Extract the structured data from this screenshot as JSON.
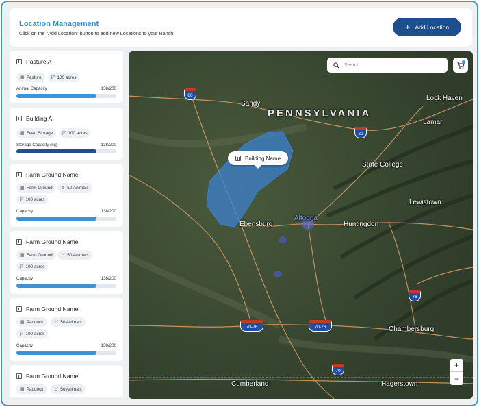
{
  "header": {
    "title": "Location Management",
    "subtitle": "Click on the \"Add Location\" button to add new Locations to your Ranch.",
    "add_button_label": "Add Location"
  },
  "colors": {
    "accent": "#3d93d6",
    "primary_button": "#1e4f8c",
    "polygon": "#3b82d6"
  },
  "locations": [
    {
      "name": "Pasture A",
      "tags": [
        {
          "icon": "grid-icon",
          "text": "Pasture"
        },
        {
          "icon": "area-icon",
          "text": "100 acres"
        }
      ],
      "bar_label": "Animal Capacity",
      "bar_value": "138/200",
      "fill_fraction": 0.8
    },
    {
      "name": "Building A",
      "tags": [
        {
          "icon": "building-icon",
          "text": "Feed Storage"
        },
        {
          "icon": "area-icon",
          "text": "100 acres"
        }
      ],
      "bar_label": "Storage Capacity (kg)",
      "bar_value": "138/200",
      "fill_fraction": 0.8
    },
    {
      "name": "Farm Ground Name",
      "tags": [
        {
          "icon": "grid-icon",
          "text": "Farm Ground"
        },
        {
          "icon": "cow-icon",
          "text": "50 Animals"
        },
        {
          "icon": "area-icon",
          "text": "100 acres"
        }
      ],
      "bar_label": "Capacity",
      "bar_value": "138/200",
      "fill_fraction": 0.8
    },
    {
      "name": "Farm Ground Name",
      "tags": [
        {
          "icon": "grid-icon",
          "text": "Farm Ground"
        },
        {
          "icon": "cow-icon",
          "text": "50 Animals"
        },
        {
          "icon": "area-icon",
          "text": "100 acres"
        }
      ],
      "bar_label": "Capacity",
      "bar_value": "138/200",
      "fill_fraction": 0.8
    },
    {
      "name": "Farm Ground Name",
      "tags": [
        {
          "icon": "paddock-icon",
          "text": "Paddock"
        },
        {
          "icon": "cow-icon",
          "text": "50 Animals"
        },
        {
          "icon": "area-icon",
          "text": "100 acres"
        }
      ],
      "bar_label": "Capacity",
      "bar_value": "138/200",
      "fill_fraction": 0.8
    },
    {
      "name": "Farm Ground Name",
      "tags": [
        {
          "icon": "paddock-icon",
          "text": "Paddock"
        },
        {
          "icon": "cow-icon",
          "text": "50 Animals"
        }
      ]
    }
  ],
  "map": {
    "search_placeholder": "Search",
    "popup_label": "Building Name",
    "zoom_in": "+",
    "zoom_out": "−",
    "labels": {
      "state": "PENNSYLVANIA",
      "sandy": "Sandy",
      "lock_haven": "Lock Haven",
      "lamar": "Lamar",
      "state_college": "State College",
      "lewistown": "Lewistown",
      "ebensburg": "Ebensburg",
      "altoona": "Altoona",
      "huntingdon": "Huntingdon",
      "chambersburg": "Chambersburg",
      "cumberland": "Cumberland",
      "hagerstown": "Hagerstown"
    },
    "shields": {
      "i80_west": "80",
      "i80_east": "80",
      "i76": "76",
      "i70_76_west": "70-76",
      "i70_76_east": "70-76",
      "i70": "70"
    }
  }
}
